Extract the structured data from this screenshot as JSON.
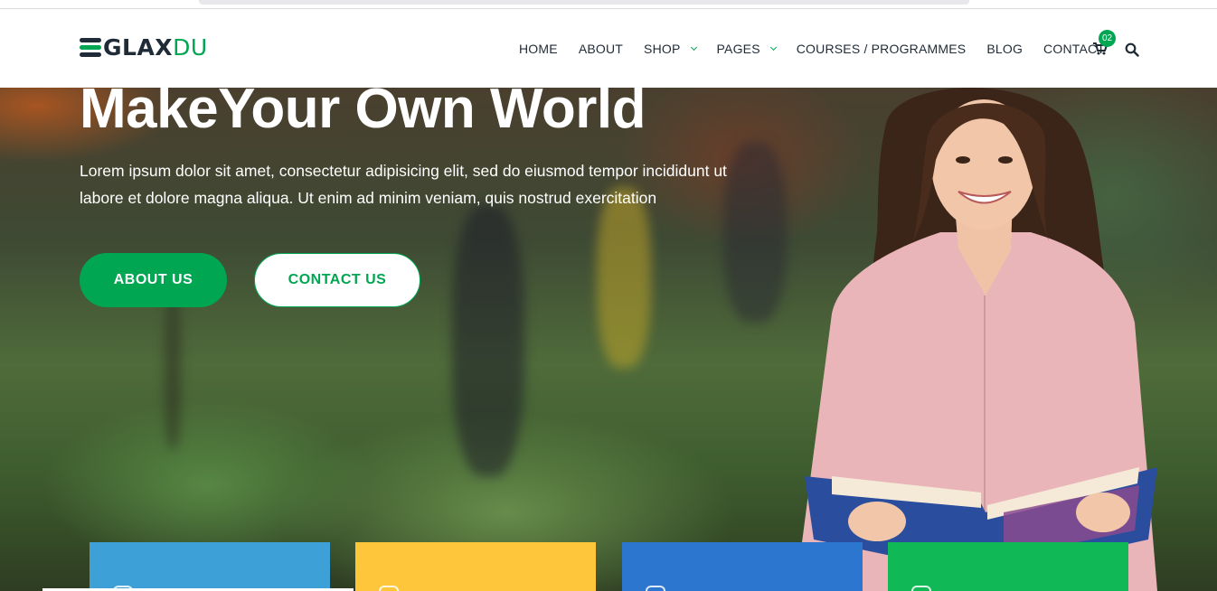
{
  "brand": {
    "part1": "GLAX",
    "part2": "DU"
  },
  "nav": {
    "items": [
      {
        "label": "HOME",
        "dropdown": false
      },
      {
        "label": "ABOUT",
        "dropdown": false
      },
      {
        "label": "SHOP",
        "dropdown": true
      },
      {
        "label": "PAGES",
        "dropdown": true
      },
      {
        "label": "COURSES / PROGRAMMES",
        "dropdown": false
      },
      {
        "label": "BLOG",
        "dropdown": false
      },
      {
        "label": "CONTACT",
        "dropdown": false
      }
    ],
    "cart_count": "02",
    "cart_icon": "shopping-cart-icon",
    "search_icon": "search-icon"
  },
  "hero": {
    "title": "MakeYour Own World",
    "text": "Lorem ipsum dolor sit amet, consectetur adipisicing elit, sed do eiusmod tempor incididunt ut labore et dolore magna aliqua. Ut enim ad minim veniam, quis nostrud exercitation",
    "primary_button": "ABOUT US",
    "secondary_button": "CONTACT US"
  },
  "tiles": [
    {
      "color": "#3da0d6"
    },
    {
      "color": "#fec63a"
    },
    {
      "color": "#2d76d0"
    },
    {
      "color": "#10b956"
    }
  ],
  "colors": {
    "accent": "#00a651",
    "dark": "#1f2b37"
  }
}
